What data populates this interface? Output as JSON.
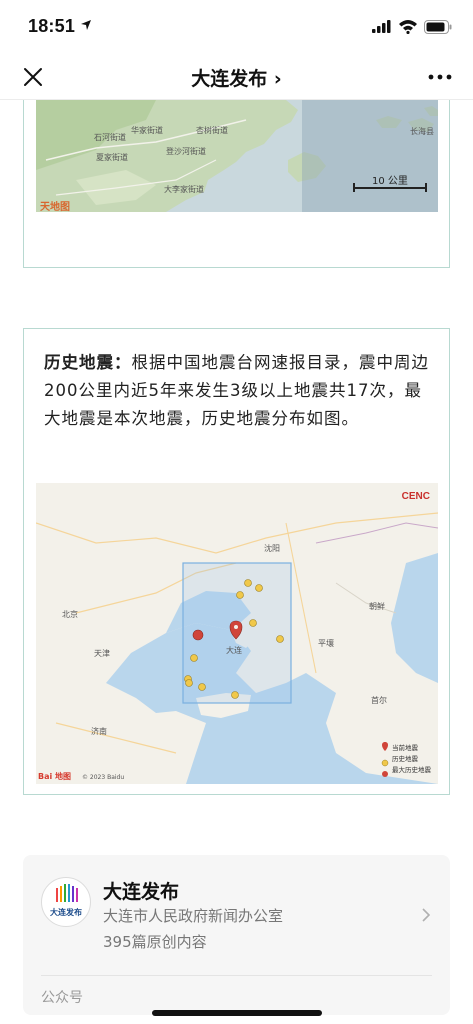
{
  "status_bar": {
    "time": "18:51"
  },
  "nav": {
    "title": "大连发布 ›"
  },
  "map1": {
    "scale_label": "10 公里",
    "watermark": "天地图",
    "place_labels": [
      "石河街道",
      "华家街道",
      "杏树街道",
      "长海县",
      "夏家街道",
      "登沙河街道",
      "炮台街道",
      "大李家街道"
    ]
  },
  "quake": {
    "heading": "历史地震：",
    "body": "根据中国地震台网速报目录，震中周边200公里内近5年来发生3级以上地震共17次，最大地震是本次地震，历史地震分布如图。"
  },
  "map2": {
    "logo": "CENC",
    "baidu": "Bai 地图",
    "copyright": "© 2023 Baidu",
    "cities": [
      "沈阳",
      "北京",
      "天津",
      "济南",
      "朝鲜",
      "平壤",
      "首尔",
      "大连"
    ],
    "legend": [
      "当前地震",
      "历史地震",
      "最大历史地震"
    ]
  },
  "account": {
    "avatar_text": "大连发布",
    "name": "大连发布",
    "org": "大连市人民政府新闻办公室",
    "count": "395篇原创内容",
    "type": "公众号"
  }
}
